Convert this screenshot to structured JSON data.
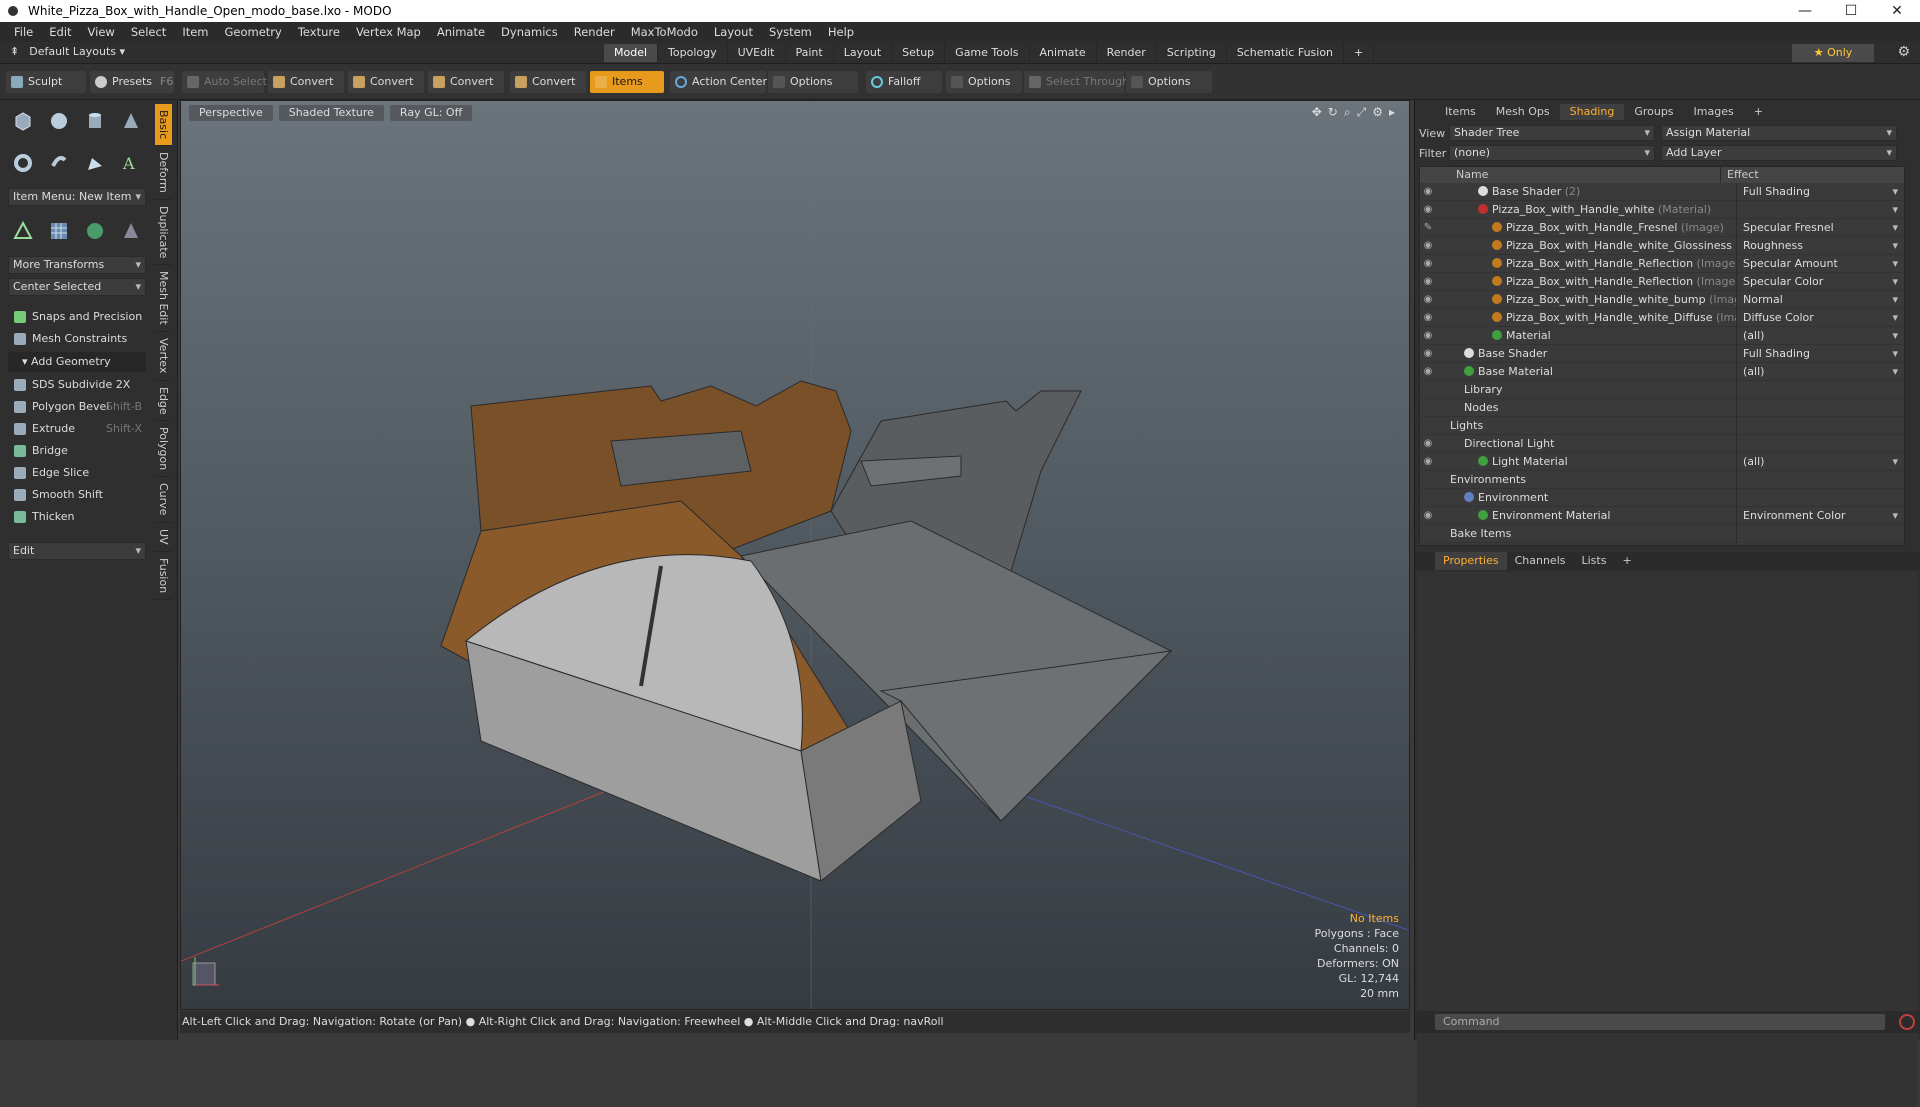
{
  "window": {
    "title": "White_Pizza_Box_with_Handle_Open_modo_base.lxo - MODO",
    "controls": [
      "—",
      "☐",
      "✕"
    ]
  },
  "menu": [
    "File",
    "Edit",
    "View",
    "Select",
    "Item",
    "Geometry",
    "Texture",
    "Vertex Map",
    "Animate",
    "Dynamics",
    "Render",
    "MaxToModo",
    "Layout",
    "System",
    "Help"
  ],
  "layout_bar": {
    "default_layouts": "Default Layouts",
    "tabs": [
      "Model",
      "Topology",
      "UVEdit",
      "Paint",
      "Layout",
      "Setup",
      "Game Tools",
      "Animate",
      "Render",
      "Scripting",
      "Schematic Fusion",
      "+"
    ],
    "active_tab": "Model",
    "only": "Only"
  },
  "toolbar": {
    "sculpt": "Sculpt",
    "presets": "Presets",
    "presets_key": "F6",
    "auto_select": "Auto Select",
    "convert1": "Convert",
    "convert2": "Convert",
    "convert3": "Convert",
    "convert4": "Convert",
    "items": "Items",
    "action_center": "Action Center",
    "options1": "Options",
    "falloff": "Falloff",
    "options2": "Options",
    "select_through": "Select Through",
    "options3": "Options"
  },
  "left_panel": {
    "item_menu": "Item Menu: New Item",
    "more_transforms": "More Transforms",
    "center_selected": "Center Selected",
    "snaps": "Snaps and Precision",
    "mesh_constraints": "Mesh Constraints",
    "add_geometry": "Add Geometry",
    "tools": [
      {
        "label": "SDS Subdivide 2X",
        "key": ""
      },
      {
        "label": "Polygon Bevel",
        "key": "Shift-B"
      },
      {
        "label": "Extrude",
        "key": "Shift-X"
      },
      {
        "label": "Bridge",
        "key": ""
      },
      {
        "label": "Edge Slice",
        "key": ""
      },
      {
        "label": "Smooth Shift",
        "key": ""
      },
      {
        "label": "Thicken",
        "key": ""
      }
    ],
    "edit": "Edit",
    "side_tabs": [
      "Basic",
      "Deform",
      "Duplicate",
      "Mesh Edit",
      "Vertex",
      "Edge",
      "Polygon",
      "Curve",
      "UV",
      "Fusion"
    ]
  },
  "viewport": {
    "view": "Perspective",
    "shading": "Shaded Texture",
    "raygl": "Ray GL: Off",
    "info": {
      "no_items": "No Items",
      "polygons": "Polygons : Face",
      "channels": "Channels: 0",
      "deformers": "Deformers: ON",
      "gl": "GL: 12,744",
      "scale": "20 mm"
    }
  },
  "status_bar": "Alt-Left Click and Drag: Navigation: Rotate (or Pan) ● Alt-Right Click and Drag: Navigation: Freewheel ● Alt-Middle Click and Drag: navRoll",
  "right_panel": {
    "tabs": [
      "Items",
      "Mesh Ops",
      "Shading",
      "Groups",
      "Images",
      "+"
    ],
    "active_tab": "Shading",
    "view_label": "View",
    "view_value": "Shader Tree",
    "assign_material": "Assign Material",
    "filter_label": "Filter",
    "filter_value": "(none)",
    "add_layer": "Add Layer",
    "col_name": "Name",
    "col_effect": "Effect",
    "rows": [
      {
        "name": "Base Shader",
        "sub": "(2)",
        "effect": "Full Shading",
        "indent": 2,
        "ball": "#dddddd",
        "eye": "👁"
      },
      {
        "name": "Pizza_Box_with_Handle_white",
        "sub": "(Material)",
        "effect": "",
        "indent": 2,
        "ball": "#c03030",
        "eye": "👁"
      },
      {
        "name": "Pizza_Box_with_Handle_Fresnel",
        "sub": "(Image)",
        "effect": "Specular Fresnel",
        "indent": 3,
        "ball": "#c07a20",
        "eye": "✎"
      },
      {
        "name": "Pizza_Box_with_Handle_white_Glossiness",
        "sub": "(I...",
        "effect": "Roughness",
        "indent": 3,
        "ball": "#c07a20",
        "eye": "👁"
      },
      {
        "name": "Pizza_Box_with_Handle_Reflection",
        "sub": "(Image)",
        "effect": "Specular Amount",
        "indent": 3,
        "ball": "#c07a20",
        "eye": "👁"
      },
      {
        "name": "Pizza_Box_with_Handle_Reflection",
        "sub": "(Image)",
        "effect": "Specular Color",
        "indent": 3,
        "ball": "#c07a20",
        "eye": "👁"
      },
      {
        "name": "Pizza_Box_with_Handle_white_bump",
        "sub": "(Image)",
        "effect": "Normal",
        "indent": 3,
        "ball": "#c07a20",
        "eye": "👁"
      },
      {
        "name": "Pizza_Box_with_Handle_white_Diffuse",
        "sub": "(Ima...",
        "effect": "Diffuse Color",
        "indent": 3,
        "ball": "#c07a20",
        "eye": "👁"
      },
      {
        "name": "Material",
        "sub": "",
        "effect": "(all)",
        "indent": 3,
        "ball": "#40a040",
        "eye": "👁"
      },
      {
        "name": "Base Shader",
        "sub": "",
        "effect": "Full Shading",
        "indent": 1,
        "ball": "#dddddd",
        "eye": "👁"
      },
      {
        "name": "Base Material",
        "sub": "",
        "effect": "(all)",
        "indent": 1,
        "ball": "#40a040",
        "eye": "👁"
      },
      {
        "name": "Library",
        "sub": "",
        "effect": "",
        "indent": 1,
        "ball": "",
        "eye": ""
      },
      {
        "name": "Nodes",
        "sub": "",
        "effect": "",
        "indent": 1,
        "ball": "",
        "eye": ""
      },
      {
        "name": "Lights",
        "sub": "",
        "effect": "",
        "indent": 0,
        "ball": "",
        "eye": ""
      },
      {
        "name": "Directional Light",
        "sub": "",
        "effect": "",
        "indent": 1,
        "ball": "",
        "eye": "👁"
      },
      {
        "name": "Light Material",
        "sub": "",
        "effect": "(all)",
        "indent": 2,
        "ball": "#40a040",
        "eye": "👁"
      },
      {
        "name": "Environments",
        "sub": "",
        "effect": "",
        "indent": 0,
        "ball": "",
        "eye": ""
      },
      {
        "name": "Environment",
        "sub": "",
        "effect": "",
        "indent": 1,
        "ball": "#6080c0",
        "eye": ""
      },
      {
        "name": "Environment Material",
        "sub": "",
        "effect": "Environment Color",
        "indent": 2,
        "ball": "#40a040",
        "eye": "👁"
      },
      {
        "name": "Bake Items",
        "sub": "",
        "effect": "",
        "indent": 0,
        "ball": "",
        "eye": ""
      }
    ],
    "props_tabs": [
      "Properties",
      "Channels",
      "Lists",
      "+"
    ],
    "props_active": "Properties",
    "command_placeholder": "Command"
  }
}
